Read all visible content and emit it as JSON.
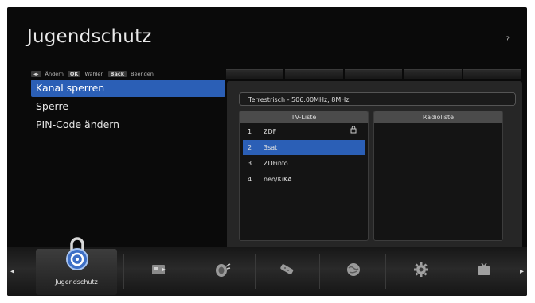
{
  "header": {
    "title": "Jugendschutz",
    "help": "?"
  },
  "keybar": {
    "items": [
      {
        "key": "◂▸",
        "label": "Ändern"
      },
      {
        "key": "OK",
        "label": "Wählen"
      },
      {
        "key": "Back",
        "label": "Beenden"
      }
    ]
  },
  "menu": {
    "items": [
      {
        "label": "Kanal sperren",
        "active": true
      },
      {
        "label": "Sperre",
        "active": false
      },
      {
        "label": "PIN-Code ändern",
        "active": false
      }
    ]
  },
  "frequency": "Terrestrisch - 506.00MHz, 8MHz",
  "tv_list": {
    "header": "TV-Liste",
    "rows": [
      {
        "num": "1",
        "name": "ZDF",
        "locked": true
      },
      {
        "num": "2",
        "name": "3sat",
        "locked": false,
        "selected": true
      },
      {
        "num": "3",
        "name": "ZDFinfo",
        "locked": false
      },
      {
        "num": "4",
        "name": "neo/KiKA",
        "locked": false
      }
    ]
  },
  "radio_list": {
    "header": "Radioliste",
    "rows": []
  },
  "dock": {
    "selected_label": "Jugendschutz",
    "items": [
      "lock-icon",
      "card-reader-icon",
      "satellite-dish-icon",
      "remote-control-icon",
      "globe-icon",
      "gear-icon",
      "tv-icon"
    ]
  },
  "colors": {
    "highlight": "#2b5fb6",
    "background": "#0a0a0a"
  }
}
